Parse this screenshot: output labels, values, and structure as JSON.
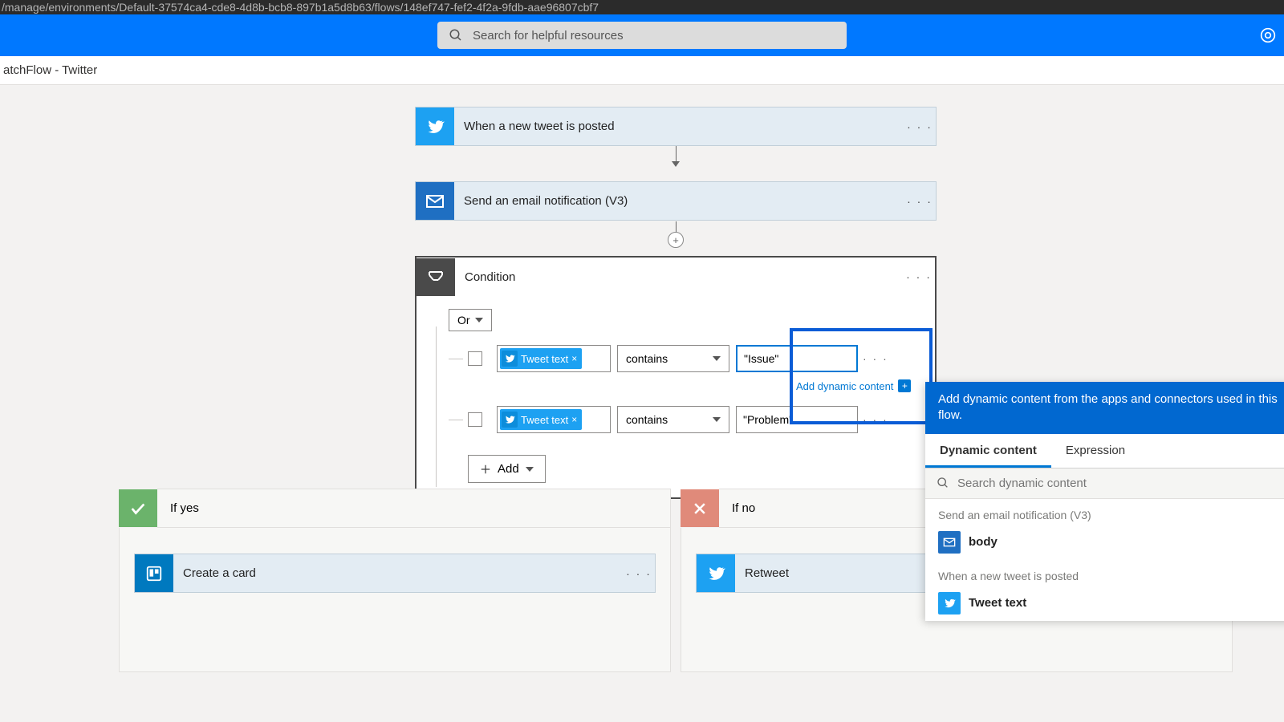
{
  "url": "/manage/environments/Default-37574ca4-cde8-4d8b-bcb8-897b1a5d8b63/flows/148ef747-fef2-4f2a-9fdb-aae96807cbf7",
  "search": {
    "placeholder": "Search for helpful resources"
  },
  "breadcrumb": "atchFlow - Twitter",
  "steps": {
    "trigger": "When a new tweet is posted",
    "email": "Send an email notification (V3)",
    "condition": "Condition"
  },
  "condition": {
    "group_op": "Or",
    "rows": [
      {
        "token": "Tweet text",
        "operator": "contains",
        "value": "\"Issue\""
      },
      {
        "token": "Tweet text",
        "operator": "contains",
        "value": "\"Problem\""
      }
    ],
    "add_label": "Add",
    "add_dynamic_label": "Add dynamic content"
  },
  "branches": {
    "yes_label": "If yes",
    "no_label": "If no",
    "yes_action": "Create a card",
    "no_action": "Retweet"
  },
  "dynamic_panel": {
    "heading": "Add dynamic content from the apps and connectors used in this flow.",
    "tab_dynamic": "Dynamic content",
    "tab_expression": "Expression",
    "search_placeholder": "Search dynamic content",
    "groups": [
      {
        "title": "Send an email notification (V3)",
        "items": [
          {
            "label": "body",
            "icon": "mail"
          }
        ]
      },
      {
        "title": "When a new tweet is posted",
        "items": [
          {
            "label": "Tweet text",
            "icon": "twitter"
          }
        ]
      }
    ]
  }
}
